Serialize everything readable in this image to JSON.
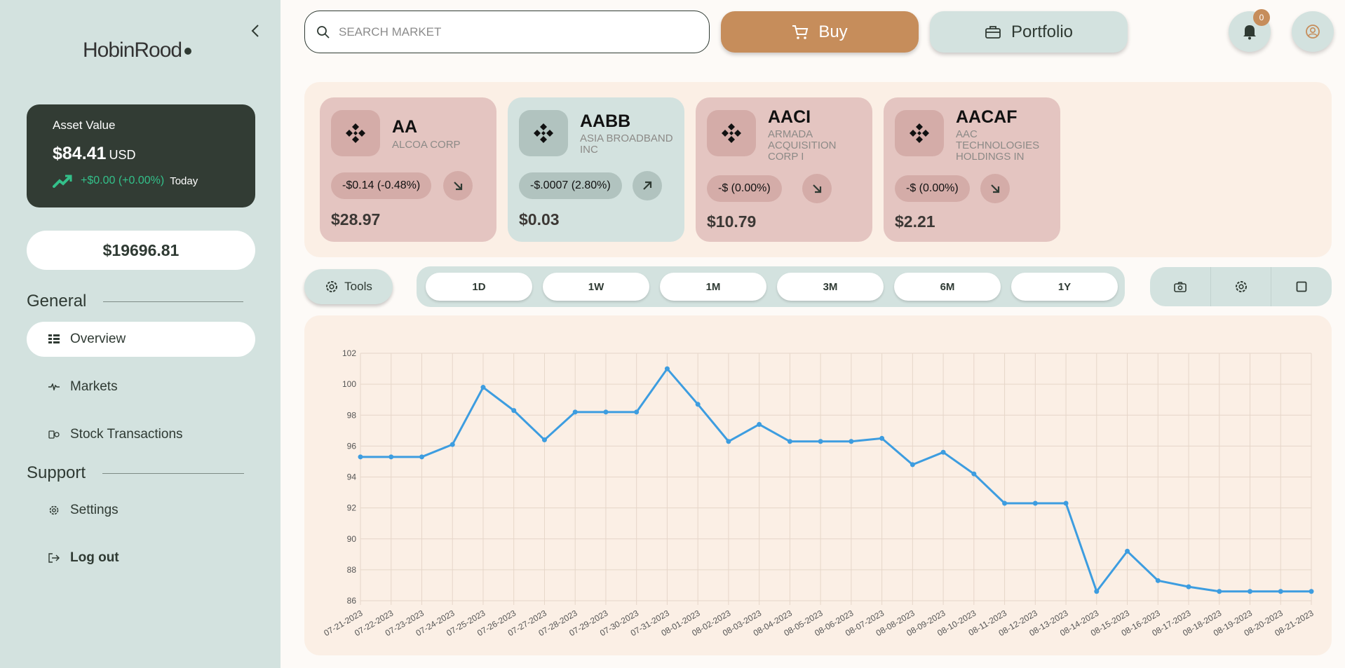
{
  "app": {
    "logo": "HobinRood"
  },
  "sidebar": {
    "asset": {
      "title": "Asset Value",
      "value": "$84.41",
      "currency": "USD",
      "change": "+$0.00 (+0.00%)",
      "period": "Today"
    },
    "balance": "$19696.81",
    "general_label": "General",
    "support_label": "Support",
    "items": [
      {
        "label": "Overview",
        "icon": "overview-icon"
      },
      {
        "label": "Markets",
        "icon": "markets-icon"
      },
      {
        "label": "Stock Transactions",
        "icon": "transactions-icon"
      }
    ],
    "support_items": [
      {
        "label": "Settings",
        "icon": "gear-icon"
      },
      {
        "label": "Log out",
        "icon": "logout-icon"
      }
    ]
  },
  "header": {
    "search_placeholder": "SEARCH MARKET",
    "buy_label": "Buy",
    "portfolio_label": "Portfolio",
    "notification_count": "0"
  },
  "stocks": [
    {
      "symbol": "AA",
      "name": "ALCOA CORP",
      "change": "-$0.14 (-0.48%)",
      "direction": "down",
      "price": "$28.97"
    },
    {
      "symbol": "AABB",
      "name": "ASIA BROADBAND INC",
      "change": "-$.0007 (2.80%)",
      "direction": "up",
      "price": "$0.03"
    },
    {
      "symbol": "AACI",
      "name": "ARMADA ACQUISITION CORP I",
      "change": "-$ (0.00%)",
      "direction": "down",
      "price": "$10.79"
    },
    {
      "symbol": "AACAF",
      "name": "AAC TECHNOLOGIES HOLDINGS IN",
      "change": "-$ (0.00%)",
      "direction": "down",
      "price": "$2.21"
    }
  ],
  "toolbar": {
    "tools_label": "Tools",
    "ranges": [
      "1D",
      "1W",
      "1M",
      "3M",
      "6M",
      "1Y"
    ]
  },
  "colors": {
    "accent": "#c68d5b",
    "sidebar": "#d3e2df",
    "line": "#3d9de0",
    "up": "#33c08a"
  },
  "chart_data": {
    "type": "line",
    "ylim": [
      86,
      102
    ],
    "yticks": [
      86,
      88,
      90,
      92,
      94,
      96,
      98,
      100,
      102
    ],
    "grid": true,
    "x": [
      "07-21-2023",
      "07-22-2023",
      "07-23-2023",
      "07-24-2023",
      "07-25-2023",
      "07-26-2023",
      "07-27-2023",
      "07-28-2023",
      "07-29-2023",
      "07-30-2023",
      "07-31-2023",
      "08-01-2023",
      "08-02-2023",
      "08-03-2023",
      "08-04-2023",
      "08-05-2023",
      "08-06-2023",
      "08-07-2023",
      "08-08-2023",
      "08-09-2023",
      "08-10-2023",
      "08-11-2023",
      "08-12-2023",
      "08-13-2023",
      "08-14-2023",
      "08-15-2023",
      "08-16-2023",
      "08-17-2023",
      "08-18-2023",
      "08-19-2023",
      "08-20-2023",
      "08-21-2023"
    ],
    "series": [
      {
        "values": [
          95.3,
          95.3,
          95.3,
          96.1,
          99.8,
          98.3,
          96.4,
          98.2,
          98.2,
          98.2,
          101.0,
          98.7,
          96.3,
          97.4,
          96.3,
          96.3,
          96.3,
          96.5,
          94.8,
          95.6,
          94.2,
          92.3,
          92.3,
          92.3,
          86.6,
          89.2,
          87.3,
          86.9,
          86.6,
          86.6,
          86.6,
          86.6
        ]
      }
    ]
  }
}
